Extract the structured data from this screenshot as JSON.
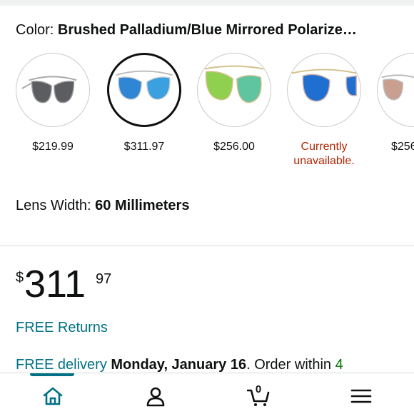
{
  "color": {
    "label": "Color: ",
    "value": "Brushed Palladium/Blue Mirrored Polarize…"
  },
  "swatches": [
    {
      "name": "gray-lens",
      "price": "$219.99",
      "unavailable": false,
      "selected": false,
      "lens_color": "#5b5d60"
    },
    {
      "name": "blue-mirror",
      "price": "$311.97",
      "unavailable": false,
      "selected": true,
      "lens_color": "#2f86d4"
    },
    {
      "name": "green-mirror",
      "price": "$256.00",
      "unavailable": false,
      "selected": false,
      "lens_color": "#8fd14f"
    },
    {
      "name": "deep-blue-mirror",
      "price": "Currently\nunavailable.",
      "unavailable": true,
      "selected": false,
      "lens_color": "#1f6fd1"
    },
    {
      "name": "copper-lens",
      "price": "$256",
      "unavailable": false,
      "selected": false,
      "lens_color": "#c9a090"
    }
  ],
  "lens": {
    "label": "Lens Width: ",
    "value": "60 Millimeters"
  },
  "price": {
    "currency": "$",
    "whole": "311",
    "fraction": "97"
  },
  "returns": "FREE Returns",
  "delivery": {
    "free_label": "FREE delivery",
    "date": "Monday, January 16",
    "order_within_text": ". Order within ",
    "time": "4"
  },
  "nav": {
    "cart_count": "0",
    "items": [
      "home",
      "account",
      "cart",
      "menu"
    ]
  },
  "colors": {
    "link": "#007185",
    "unavailable": "#b12704",
    "green": "#007600"
  }
}
